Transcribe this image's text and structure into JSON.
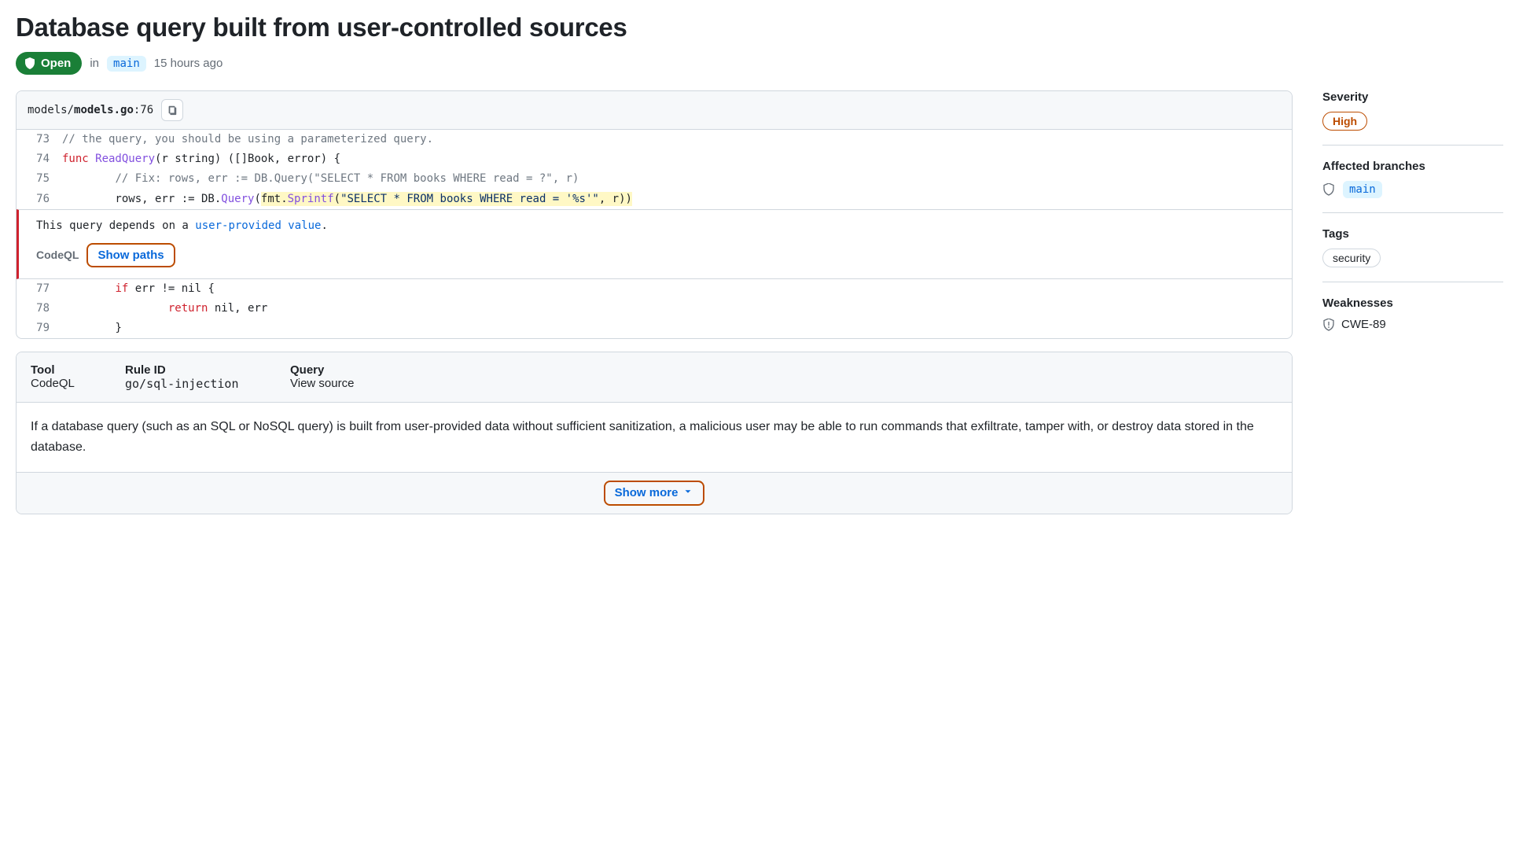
{
  "title": "Database query built from user-controlled sources",
  "status": {
    "state": "Open"
  },
  "meta": {
    "in": "in",
    "branch": "main",
    "time": "15 hours ago"
  },
  "file": {
    "path_prefix": "models/",
    "path_bold": "models.go",
    "path_suffix": ":76"
  },
  "code": {
    "lines": [
      {
        "n": "73"
      },
      {
        "n": "74"
      },
      {
        "n": "75"
      },
      {
        "n": "76"
      },
      {
        "n": "77"
      },
      {
        "n": "78"
      },
      {
        "n": "79"
      }
    ],
    "l73_comment": "// the query, you should be using a parameterized query.",
    "l74_kw": "func",
    "l74_fn": " ReadQuery",
    "l74_rest": "(r string) ([]Book, error) {",
    "l75_comment": "// Fix: rows, err := DB.Query(\"SELECT * FROM books WHERE read = ?\", r)",
    "l76_pre": "        rows, err := DB.",
    "l76_q": "Query",
    "l76_open": "(",
    "l76_fmt": "fmt",
    "l76_dot": ".",
    "l76_sp": "Sprintf",
    "l76_openp": "(",
    "l76_str": "\"SELECT * FROM books WHERE read = '%s'\"",
    "l76_close": ", r))",
    "l77_kw": "if",
    "l77_rest": " err != nil {",
    "l78_kw": "return",
    "l78_rest": " nil, err",
    "l79_brace": "}"
  },
  "alert": {
    "text_pre": "This query depends on a ",
    "text_link": "user-provided value",
    "text_post": ".",
    "tool": "CodeQL",
    "show_paths": "Show paths"
  },
  "info": {
    "tool_h": "Tool",
    "tool_v": "CodeQL",
    "rule_h": "Rule ID",
    "rule_v": "go/sql-injection",
    "query_h": "Query",
    "query_v": "View source"
  },
  "description": "If a database query (such as an SQL or NoSQL query) is built from user-provided data without sufficient sanitization, a malicious user may be able to run commands that exfiltrate, tamper with, or destroy data stored in the database.",
  "show_more": "Show more",
  "sidebar": {
    "severity_h": "Severity",
    "severity_v": "High",
    "branches_h": "Affected branches",
    "branches_v": "main",
    "tags_h": "Tags",
    "tags_v": "security",
    "weak_h": "Weaknesses",
    "weak_v": "CWE-89"
  }
}
